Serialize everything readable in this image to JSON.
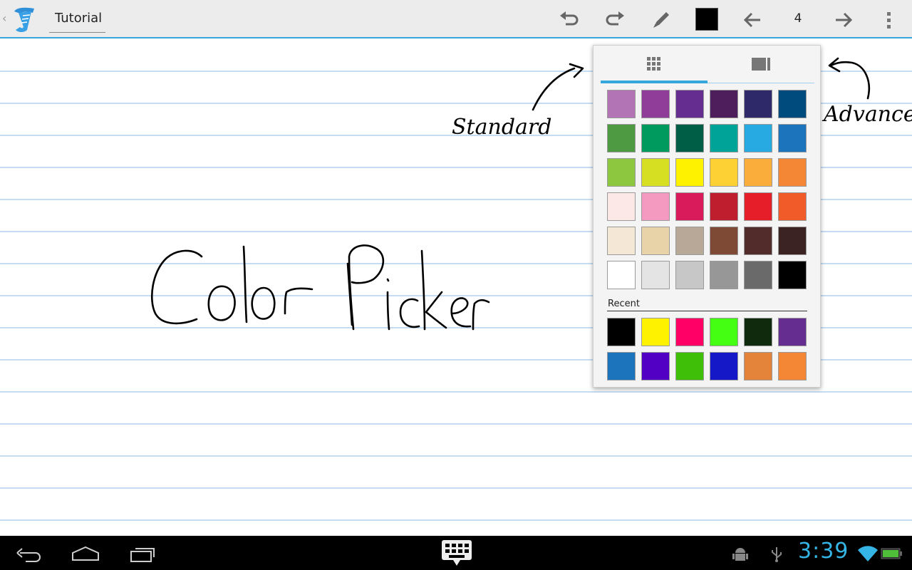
{
  "actionbar": {
    "title": "Tutorial",
    "page_number": "4",
    "current_color": "#000000",
    "icons": [
      "up-caret",
      "app-icon",
      "undo-icon",
      "redo-icon",
      "pen-icon",
      "arrow-left-icon",
      "arrow-right-icon",
      "overflow-menu-icon"
    ]
  },
  "canvas": {
    "handwriting": "Color Picker",
    "annotation_standard": "Standard",
    "annotation_advanced": "Advanced",
    "rule_color": "#c5dcf2"
  },
  "color_picker": {
    "tabs": [
      {
        "name": "standard",
        "icon": "grid-icon",
        "selected": true
      },
      {
        "name": "advanced",
        "icon": "advanced-panel-icon",
        "selected": false
      }
    ],
    "standard_colors": [
      [
        "#b274b5",
        "#8f3d98",
        "#662d91",
        "#4e1e5c",
        "#2e2a6a",
        "#004b7e"
      ],
      [
        "#4e9a42",
        "#009a5e",
        "#005e46",
        "#00a398",
        "#27a9e1",
        "#1c75bc"
      ],
      [
        "#8dc63f",
        "#d7df23",
        "#fff200",
        "#fdd033",
        "#fbad3b",
        "#f38736"
      ],
      [
        "#fde8e8",
        "#f49ac1",
        "#d91b5c",
        "#be1e2d",
        "#e61e2a",
        "#f15a29"
      ],
      [
        "#f5e7d6",
        "#e8d3a8",
        "#b7a897",
        "#7e4a35",
        "#522c2b",
        "#3c2323"
      ],
      [
        "#ffffff",
        "#e4e4e4",
        "#c7c7c7",
        "#979797",
        "#6a6a6a",
        "#000000"
      ]
    ],
    "recent_label": "Recent",
    "recent_colors": [
      [
        "#000000",
        "#fff200",
        "#ff0066",
        "#44ff11",
        "#0f2a0c",
        "#662d91"
      ],
      [
        "#1c75bc",
        "#5200c4",
        "#3fbf07",
        "#1418c6",
        "#e4843b",
        "#f38736"
      ]
    ]
  },
  "navbar": {
    "clock": "3:39",
    "icons": [
      "back-icon",
      "home-icon",
      "recents-icon",
      "keyboard-icon",
      "android-debug-icon",
      "usb-icon",
      "wifi-icon",
      "battery-icon"
    ]
  },
  "colors": {
    "accent": "#35a7dc",
    "clock": "#35b5e5"
  }
}
